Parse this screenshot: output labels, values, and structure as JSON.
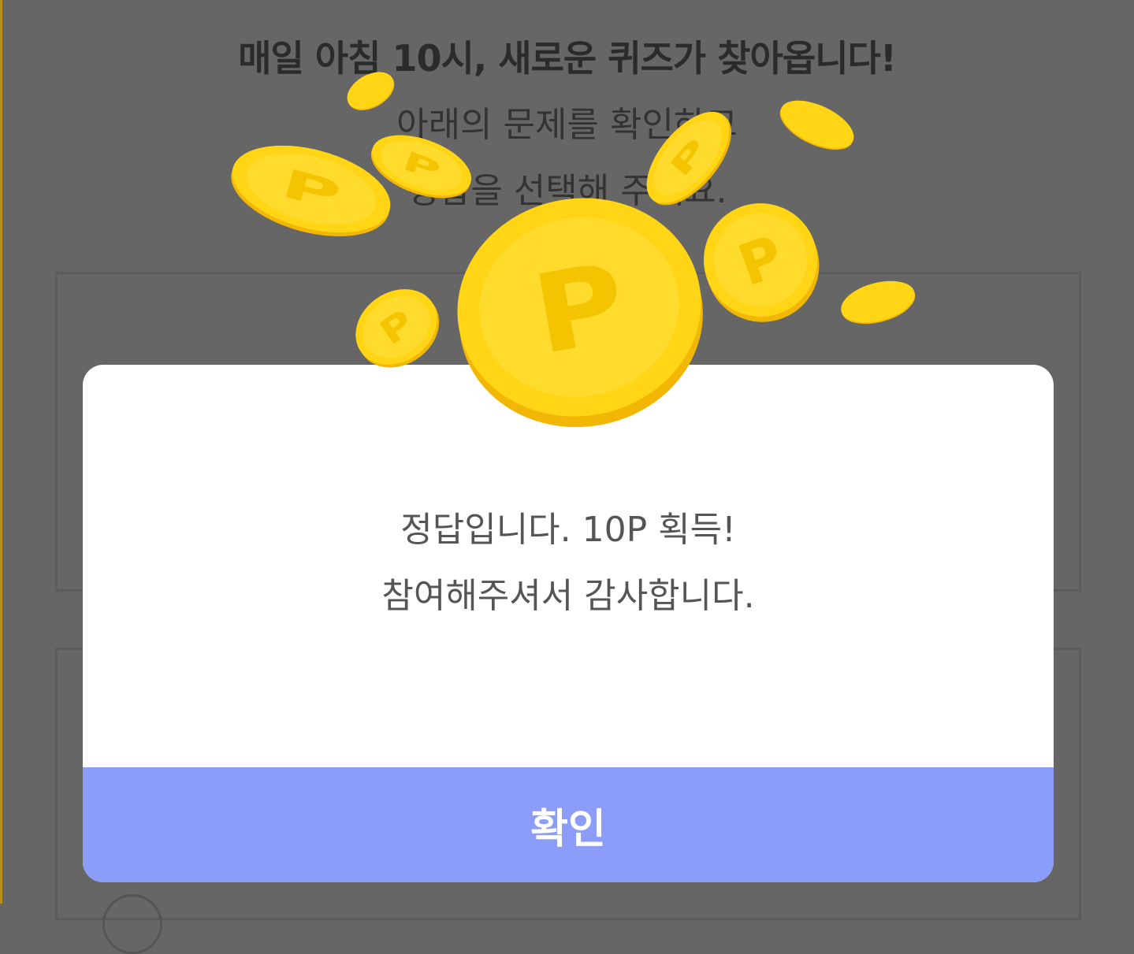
{
  "background": {
    "title": "매일 아침 10시, 새로운 퀴즈가 찾아옵니다!",
    "subtitle_line1": "아래의 문제를 확인하고",
    "subtitle_line2": "정답을 선택해 주세요."
  },
  "modal": {
    "message_line1": "정답입니다. 10P 획득!",
    "message_line2": "참여해주셔서 감사합니다.",
    "confirm_label": "확인"
  },
  "coin": {
    "symbol": "P"
  },
  "colors": {
    "overlay_bg": "#666666",
    "confirm_button": "#8c9cf9",
    "coin_face": "#ffd515",
    "coin_edge": "#f2b705"
  }
}
